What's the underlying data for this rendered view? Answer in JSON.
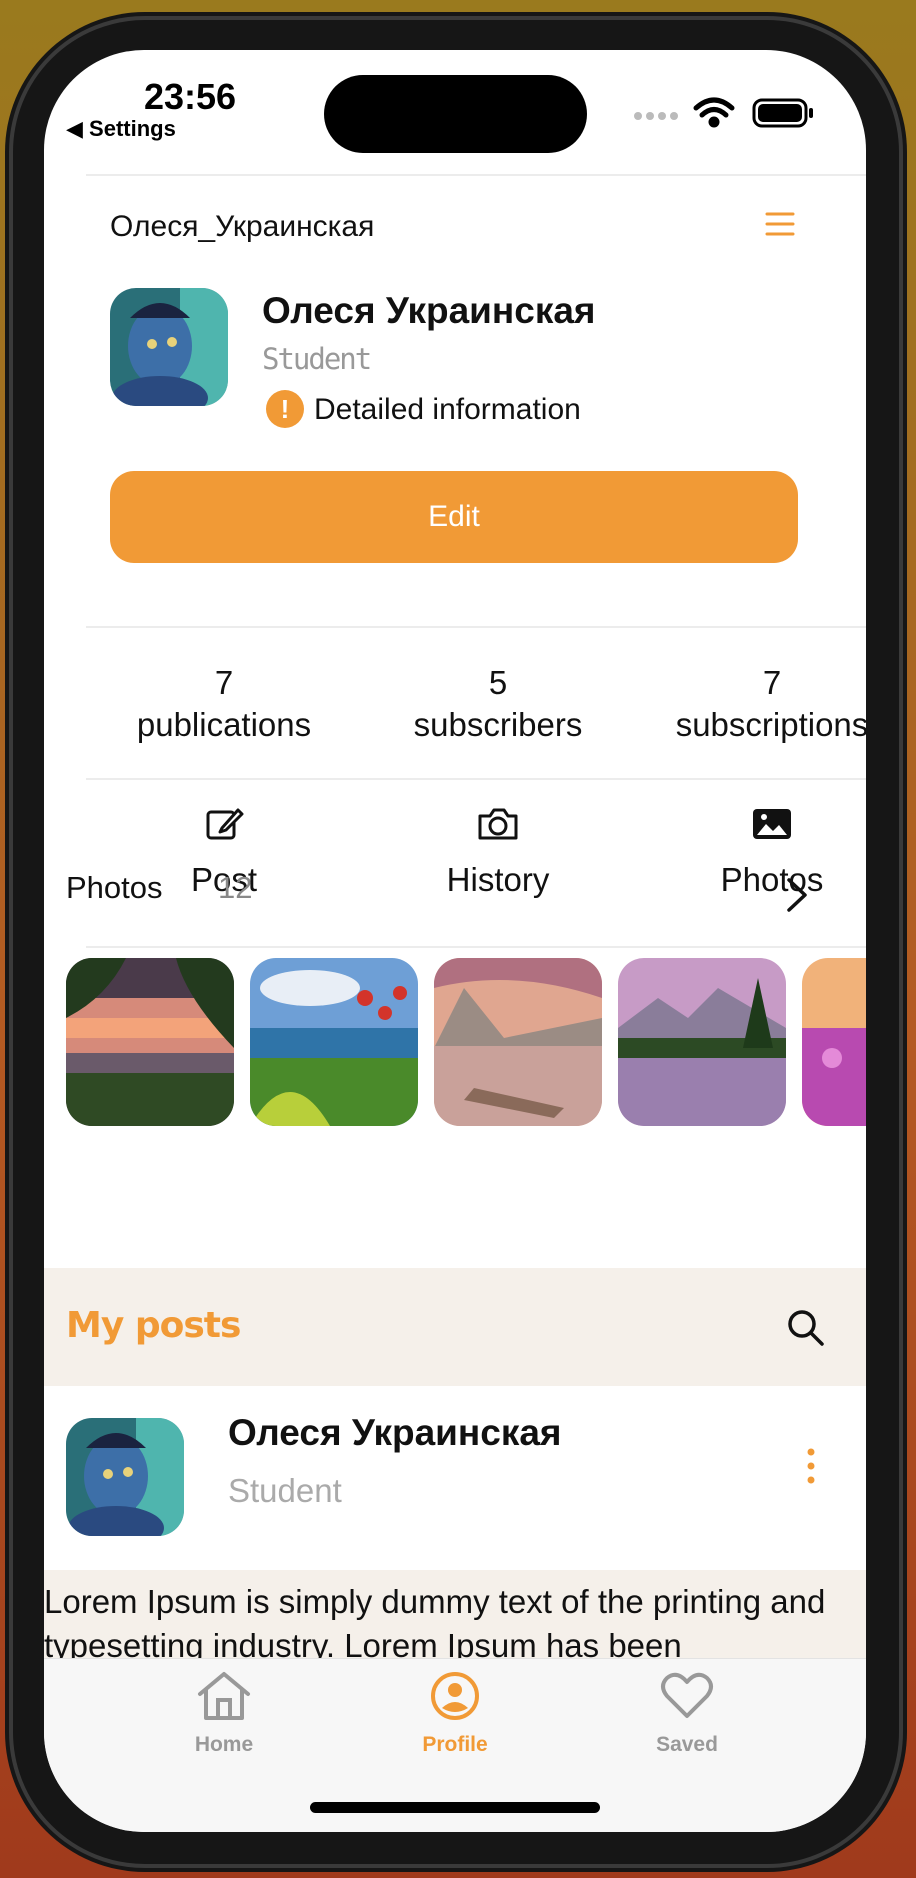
{
  "status_bar": {
    "time": "23:56",
    "back_label": "◀ Settings"
  },
  "profile": {
    "username": "Олеся_Украинская",
    "name": "Олеся Украинская",
    "role": "Student",
    "detail_label": "Detailed information",
    "edit_label": "Edit"
  },
  "stats": [
    {
      "count": "7",
      "label": "publications",
      "active": true
    },
    {
      "count": "5",
      "label": "subscribers",
      "active": false
    },
    {
      "count": "7",
      "label": "subscriptions",
      "active": false
    }
  ],
  "actions": [
    {
      "label": "Post",
      "icon": "edit-icon"
    },
    {
      "label": "History",
      "icon": "camera-icon"
    },
    {
      "label": "Photos",
      "icon": "image-icon"
    }
  ],
  "photos": {
    "title": "Photos",
    "count": "12"
  },
  "posts": {
    "title": "My posts",
    "author": "Олеся Украинская",
    "role": "Student",
    "body": "Lorem Ipsum is simply dummy text of the printing and typesetting industry. Lorem Ipsum has been"
  },
  "tabs": [
    {
      "label": "Home",
      "icon": "home-icon",
      "active": false
    },
    {
      "label": "Profile",
      "icon": "profile-icon",
      "active": true
    },
    {
      "label": "Saved",
      "icon": "heart-icon",
      "active": false
    }
  ],
  "colors": {
    "accent": "#f19a36",
    "background_tint": "#f5f0ea"
  }
}
